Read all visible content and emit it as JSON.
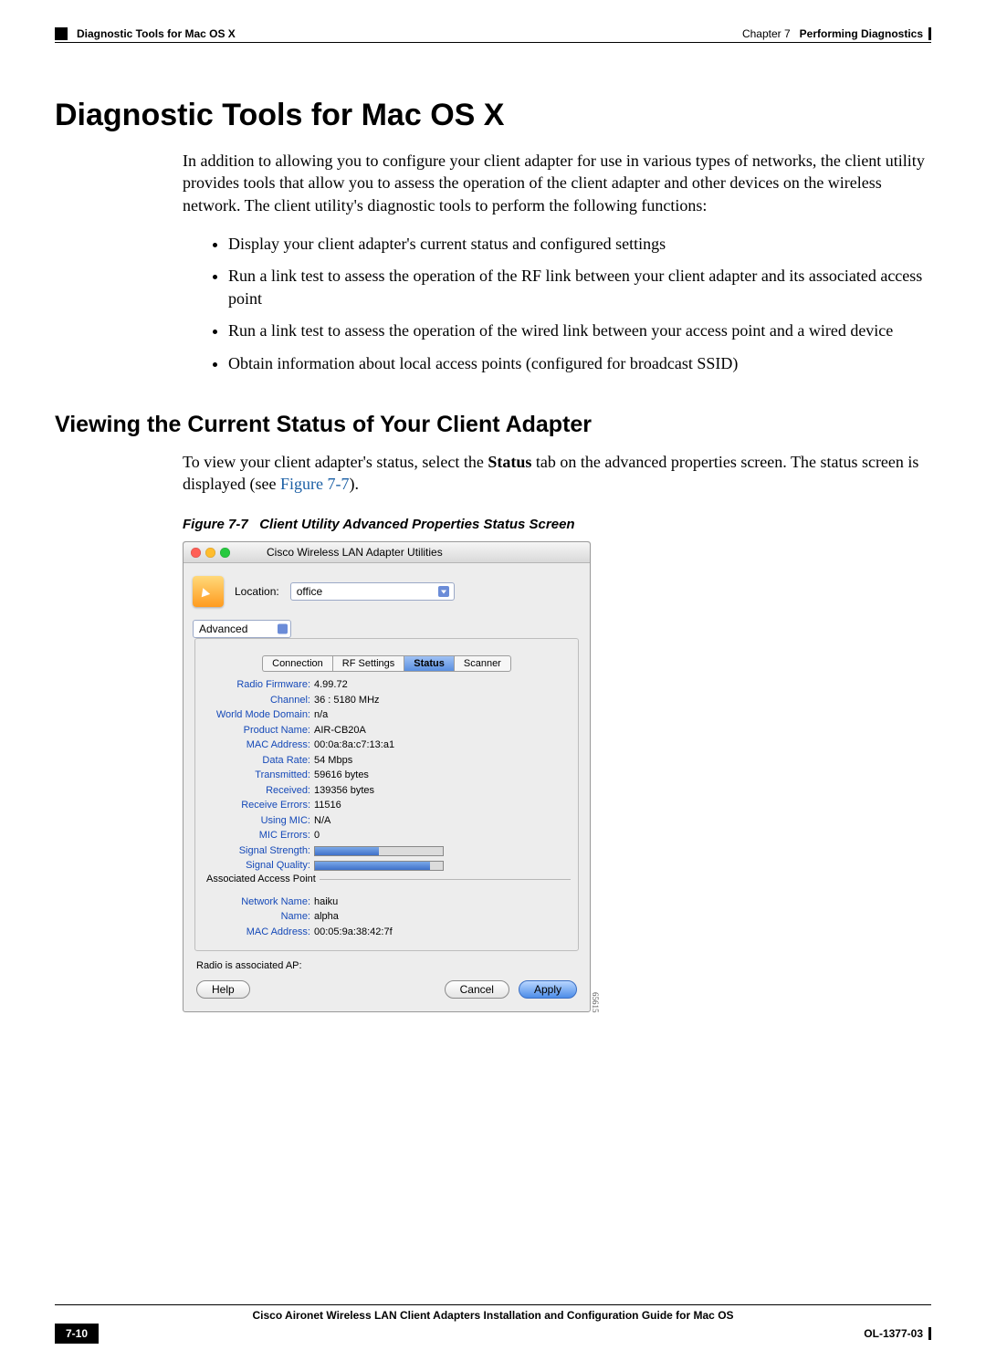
{
  "header": {
    "section": "Diagnostic Tools for Mac OS X",
    "chapter_label": "Chapter 7",
    "chapter_title": "Performing Diagnostics"
  },
  "h1": "Diagnostic Tools for Mac OS X",
  "intro": "In addition to allowing you to configure your client adapter for use in various types of networks, the client utility provides tools that allow you to assess the operation of the client adapter and other devices on the wireless network. The client utility's diagnostic tools to perform the following functions:",
  "bullets": [
    "Display your client adapter's current status and configured settings",
    "Run a link test to assess the operation of the RF link between your client adapter and its associated access point",
    "Run a link test to assess the operation of the wired link between your access point and a wired device",
    "Obtain information about local access points (configured for broadcast SSID)"
  ],
  "h2": "Viewing the Current Status of Your Client Adapter",
  "view_para_1": "To view your client adapter's status, select the ",
  "view_para_bold": "Status",
  "view_para_2": " tab on the advanced properties screen. The status screen is displayed (see ",
  "view_para_figref": "Figure 7-7",
  "view_para_3": ").",
  "figure_caption_num": "Figure 7-7",
  "figure_caption_title": "Client Utility Advanced Properties Status Screen",
  "window": {
    "title": "Cisco Wireless LAN Adapter Utilities",
    "location_label": "Location:",
    "location_value": "office",
    "popup_value": "Advanced",
    "tabs": [
      "Connection",
      "RF Settings",
      "Status",
      "Scanner"
    ],
    "active_tab": "Status",
    "rows": {
      "radio_firmware_label": "Radio Firmware:",
      "radio_firmware_value": "4.99.72",
      "channel_label": "Channel:",
      "channel_value": "36 : 5180 MHz",
      "world_mode_label": "World Mode Domain:",
      "world_mode_value": "n/a",
      "product_label": "Product Name:",
      "product_value": "AIR-CB20A",
      "mac_label": "MAC Address:",
      "mac_value": "00:0a:8a:c7:13:a1",
      "data_rate_label": "Data Rate:",
      "data_rate_value": "54 Mbps",
      "transmitted_label": "Transmitted:",
      "transmitted_value": "59616 bytes",
      "received_label": "Received:",
      "received_value": "139356 bytes",
      "recv_err_label": "Receive Errors:",
      "recv_err_value": "11516",
      "mic_label": "Using MIC:",
      "mic_value": "N/A",
      "mic_err_label": "MIC Errors:",
      "mic_err_value": "0",
      "sig_str_label": "Signal Strength:",
      "sig_qual_label": "Signal Quality:"
    },
    "group_title": "Associated Access Point",
    "ap": {
      "network_label": "Network Name:",
      "network_value": "haiku",
      "name_label": "Name:",
      "name_value": "alpha",
      "mac_label": "MAC Address:",
      "mac_value": "00:05:9a:38:42:7f"
    },
    "status_line": "Radio is associated  AP:",
    "btn_help": "Help",
    "btn_cancel": "Cancel",
    "btn_apply": "Apply",
    "image_id": "65615"
  },
  "chart_data": {
    "type": "bar",
    "title": "Signal meters",
    "series": [
      {
        "name": "Signal Strength",
        "values": [
          50
        ]
      },
      {
        "name": "Signal Quality",
        "values": [
          90
        ]
      }
    ],
    "xlabel": "",
    "ylabel": "",
    "ylim": [
      0,
      100
    ]
  },
  "footer": {
    "guide": "Cisco Aironet Wireless LAN Client Adapters Installation and Configuration Guide for Mac OS",
    "page": "7-10",
    "doc_id": "OL-1377-03"
  }
}
